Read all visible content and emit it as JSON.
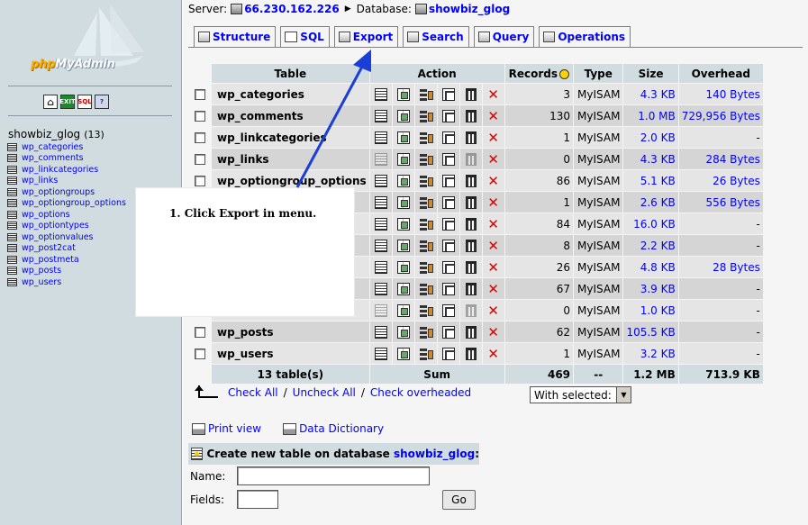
{
  "app": {
    "logo_text_php": "php",
    "logo_text_rest": "MyAdmin"
  },
  "quick_icons": [
    "home-icon",
    "exit-icon",
    "sql-icon",
    "query-window-icon"
  ],
  "quick_icon_labels": {
    "exit": "EXIT",
    "sql": "SQL"
  },
  "sidebar": {
    "db_name": "showbiz_glog",
    "table_count": "(13)",
    "tables": [
      "wp_categories",
      "wp_comments",
      "wp_linkcategories",
      "wp_links",
      "wp_optiongroups",
      "wp_optiongroup_options",
      "wp_options",
      "wp_optiontypes",
      "wp_optionvalues",
      "wp_post2cat",
      "wp_postmeta",
      "wp_posts",
      "wp_users"
    ]
  },
  "serverbar": {
    "server_label": "Server:",
    "server": "66.230.162.226",
    "database_label": "Database:",
    "database": "showbiz_glog"
  },
  "tabs": [
    {
      "label": "Structure",
      "icon": "structure-icon"
    },
    {
      "label": "SQL",
      "icon": "sql-icon"
    },
    {
      "label": "Export",
      "icon": "export-icon"
    },
    {
      "label": "Search",
      "icon": "search-icon"
    },
    {
      "label": "Query",
      "icon": "query-icon"
    },
    {
      "label": "Operations",
      "icon": "operations-icon"
    }
  ],
  "table": {
    "headers": {
      "table": "Table",
      "action": "Action",
      "records": "Records",
      "type": "Type",
      "size": "Size",
      "overhead": "Overhead"
    },
    "rows": [
      {
        "name": "wp_categories",
        "records": "3",
        "type": "MyISAM",
        "size": "4.3 KB",
        "overhead": "140 Bytes",
        "empty": false
      },
      {
        "name": "wp_comments",
        "records": "130",
        "type": "MyISAM",
        "size": "1.0 MB",
        "overhead": "729,956 Bytes",
        "empty": false
      },
      {
        "name": "wp_linkcategories",
        "records": "1",
        "type": "MyISAM",
        "size": "2.0 KB",
        "overhead": "-",
        "empty": false
      },
      {
        "name": "wp_links",
        "records": "0",
        "type": "MyISAM",
        "size": "4.3 KB",
        "overhead": "284 Bytes",
        "empty": true
      },
      {
        "name": "wp_optiongroup_options",
        "records": "86",
        "type": "MyISAM",
        "size": "5.1 KB",
        "overhead": "26 Bytes",
        "empty": false
      },
      {
        "name": "",
        "records": "1",
        "type": "MyISAM",
        "size": "2.6 KB",
        "overhead": "556 Bytes",
        "empty": false
      },
      {
        "name": "",
        "records": "84",
        "type": "MyISAM",
        "size": "16.0 KB",
        "overhead": "-",
        "empty": false
      },
      {
        "name": "",
        "records": "8",
        "type": "MyISAM",
        "size": "2.2 KB",
        "overhead": "-",
        "empty": false
      },
      {
        "name": "",
        "records": "26",
        "type": "MyISAM",
        "size": "4.8 KB",
        "overhead": "28 Bytes",
        "empty": false
      },
      {
        "name": "",
        "records": "67",
        "type": "MyISAM",
        "size": "3.9 KB",
        "overhead": "-",
        "empty": false
      },
      {
        "name": "",
        "records": "0",
        "type": "MyISAM",
        "size": "1.0 KB",
        "overhead": "-",
        "empty": true
      },
      {
        "name": "wp_posts",
        "records": "62",
        "type": "MyISAM",
        "size": "105.5 KB",
        "overhead": "-",
        "empty": false
      },
      {
        "name": "wp_users",
        "records": "1",
        "type": "MyISAM",
        "size": "3.2 KB",
        "overhead": "-",
        "empty": false
      }
    ],
    "footer": {
      "tables": "13 table(s)",
      "sum_label": "Sum",
      "records": "469",
      "type": "--",
      "size": "1.2 MB",
      "overhead": "713.9 KB"
    }
  },
  "check_links": {
    "check_all": "Check All",
    "uncheck_all": "Uncheck All",
    "check_overheaded": "Check overheaded",
    "sep": "/"
  },
  "with_selected": {
    "value": "With selected:"
  },
  "bottom_links": {
    "print_view": "Print view",
    "data_dictionary": "Data Dictionary"
  },
  "create_table": {
    "title_prefix": "Create new table on database",
    "db": "showbiz_glog",
    "title_suffix": ":",
    "name_label": "Name:",
    "fields_label": "Fields:",
    "go_label": "Go"
  },
  "annotation": {
    "text": "1. Click Export in menu.",
    "arrow_color": "#1a3fd6"
  }
}
